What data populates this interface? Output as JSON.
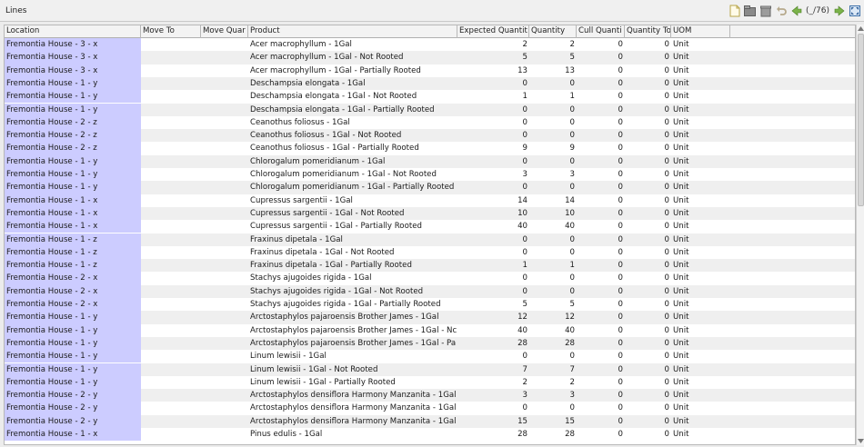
{
  "window": {
    "title": "Lines"
  },
  "toolbar": {
    "page_indicator": "(_/76)"
  },
  "columns": [
    "Location",
    "Move To",
    "Move Quar",
    "Product",
    "Expected Quantit",
    "Quantity",
    "Cull Quanti",
    "Quantity To",
    "UOM"
  ],
  "rows": [
    {
      "location": "Fremontia House - 3 - x",
      "move_to": "",
      "move_qty": "",
      "product": "Acer macrophyllum - 1Gal",
      "expected": "2",
      "quantity": "2",
      "cull": "0",
      "qty_to": "0",
      "uom": "Unit"
    },
    {
      "location": "Fremontia House - 3 - x",
      "move_to": "",
      "move_qty": "",
      "product": "Acer macrophyllum - 1Gal - Not Rooted",
      "expected": "5",
      "quantity": "5",
      "cull": "0",
      "qty_to": "0",
      "uom": "Unit"
    },
    {
      "location": "Fremontia House - 3 - x",
      "move_to": "",
      "move_qty": "",
      "product": "Acer macrophyllum - 1Gal - Partially Rooted",
      "expected": "13",
      "quantity": "13",
      "cull": "0",
      "qty_to": "0",
      "uom": "Unit"
    },
    {
      "location": "Fremontia House - 1 - y",
      "move_to": "",
      "move_qty": "",
      "product": "Deschampsia elongata - 1Gal",
      "expected": "0",
      "quantity": "0",
      "cull": "0",
      "qty_to": "0",
      "uom": "Unit"
    },
    {
      "location": "Fremontia House - 1 - y",
      "move_to": "",
      "move_qty": "",
      "product": "Deschampsia elongata - 1Gal - Not Rooted",
      "expected": "1",
      "quantity": "1",
      "cull": "0",
      "qty_to": "0",
      "uom": "Unit"
    },
    {
      "location": "Fremontia House - 1 - y",
      "move_to": "",
      "move_qty": "",
      "product": "Deschampsia elongata - 1Gal - Partially Rooted",
      "expected": "0",
      "quantity": "0",
      "cull": "0",
      "qty_to": "0",
      "uom": "Unit"
    },
    {
      "location": "Fremontia House - 2 - z",
      "move_to": "",
      "move_qty": "",
      "product": "Ceanothus foliosus - 1Gal",
      "expected": "0",
      "quantity": "0",
      "cull": "0",
      "qty_to": "0",
      "uom": "Unit"
    },
    {
      "location": "Fremontia House - 2 - z",
      "move_to": "",
      "move_qty": "",
      "product": "Ceanothus foliosus - 1Gal - Not Rooted",
      "expected": "0",
      "quantity": "0",
      "cull": "0",
      "qty_to": "0",
      "uom": "Unit"
    },
    {
      "location": "Fremontia House - 2 - z",
      "move_to": "",
      "move_qty": "",
      "product": "Ceanothus foliosus - 1Gal - Partially Rooted",
      "expected": "9",
      "quantity": "9",
      "cull": "0",
      "qty_to": "0",
      "uom": "Unit"
    },
    {
      "location": "Fremontia House - 1 - y",
      "move_to": "",
      "move_qty": "",
      "product": "Chlorogalum pomeridianum - 1Gal",
      "expected": "0",
      "quantity": "0",
      "cull": "0",
      "qty_to": "0",
      "uom": "Unit"
    },
    {
      "location": "Fremontia House - 1 - y",
      "move_to": "",
      "move_qty": "",
      "product": "Chlorogalum pomeridianum - 1Gal - Not Rooted",
      "expected": "3",
      "quantity": "3",
      "cull": "0",
      "qty_to": "0",
      "uom": "Unit"
    },
    {
      "location": "Fremontia House - 1 - y",
      "move_to": "",
      "move_qty": "",
      "product": "Chlorogalum pomeridianum - 1Gal - Partially Rooted",
      "expected": "0",
      "quantity": "0",
      "cull": "0",
      "qty_to": "0",
      "uom": "Unit"
    },
    {
      "location": "Fremontia House - 1 - x",
      "move_to": "",
      "move_qty": "",
      "product": "Cupressus sargentii - 1Gal",
      "expected": "14",
      "quantity": "14",
      "cull": "0",
      "qty_to": "0",
      "uom": "Unit"
    },
    {
      "location": "Fremontia House - 1 - x",
      "move_to": "",
      "move_qty": "",
      "product": "Cupressus sargentii - 1Gal - Not Rooted",
      "expected": "10",
      "quantity": "10",
      "cull": "0",
      "qty_to": "0",
      "uom": "Unit"
    },
    {
      "location": "Fremontia House - 1 - x",
      "move_to": "",
      "move_qty": "",
      "product": "Cupressus sargentii - 1Gal - Partially Rooted",
      "expected": "40",
      "quantity": "40",
      "cull": "0",
      "qty_to": "0",
      "uom": "Unit"
    },
    {
      "location": "Fremontia House - 1 - z",
      "move_to": "",
      "move_qty": "",
      "product": "Fraxinus dipetala - 1Gal",
      "expected": "0",
      "quantity": "0",
      "cull": "0",
      "qty_to": "0",
      "uom": "Unit"
    },
    {
      "location": "Fremontia House - 1 - z",
      "move_to": "",
      "move_qty": "",
      "product": "Fraxinus dipetala - 1Gal - Not Rooted",
      "expected": "0",
      "quantity": "0",
      "cull": "0",
      "qty_to": "0",
      "uom": "Unit"
    },
    {
      "location": "Fremontia House - 1 - z",
      "move_to": "",
      "move_qty": "",
      "product": "Fraxinus dipetala - 1Gal - Partially Rooted",
      "expected": "1",
      "quantity": "1",
      "cull": "0",
      "qty_to": "0",
      "uom": "Unit"
    },
    {
      "location": "Fremontia House - 2 - x",
      "move_to": "",
      "move_qty": "",
      "product": "Stachys ajugoides rigida - 1Gal",
      "expected": "0",
      "quantity": "0",
      "cull": "0",
      "qty_to": "0",
      "uom": "Unit"
    },
    {
      "location": "Fremontia House - 2 - x",
      "move_to": "",
      "move_qty": "",
      "product": "Stachys ajugoides rigida - 1Gal - Not Rooted",
      "expected": "0",
      "quantity": "0",
      "cull": "0",
      "qty_to": "0",
      "uom": "Unit"
    },
    {
      "location": "Fremontia House - 2 - x",
      "move_to": "",
      "move_qty": "",
      "product": "Stachys ajugoides rigida - 1Gal - Partially Rooted",
      "expected": "5",
      "quantity": "5",
      "cull": "0",
      "qty_to": "0",
      "uom": "Unit"
    },
    {
      "location": "Fremontia House - 1 - y",
      "move_to": "",
      "move_qty": "",
      "product": "Arctostaphylos pajaroensis Brother James - 1Gal",
      "expected": "12",
      "quantity": "12",
      "cull": "0",
      "qty_to": "0",
      "uom": "Unit"
    },
    {
      "location": "Fremontia House - 1 - y",
      "move_to": "",
      "move_qty": "",
      "product": "Arctostaphylos pajaroensis Brother James - 1Gal - Nc",
      "expected": "40",
      "quantity": "40",
      "cull": "0",
      "qty_to": "0",
      "uom": "Unit"
    },
    {
      "location": "Fremontia House - 1 - y",
      "move_to": "",
      "move_qty": "",
      "product": "Arctostaphylos pajaroensis Brother James - 1Gal - Pa",
      "expected": "28",
      "quantity": "28",
      "cull": "0",
      "qty_to": "0",
      "uom": "Unit"
    },
    {
      "location": "Fremontia House - 1 - y",
      "move_to": "",
      "move_qty": "",
      "product": "Linum lewisii - 1Gal",
      "expected": "0",
      "quantity": "0",
      "cull": "0",
      "qty_to": "0",
      "uom": "Unit"
    },
    {
      "location": "Fremontia House - 1 - y",
      "move_to": "",
      "move_qty": "",
      "product": "Linum lewisii - 1Gal - Not Rooted",
      "expected": "7",
      "quantity": "7",
      "cull": "0",
      "qty_to": "0",
      "uom": "Unit"
    },
    {
      "location": "Fremontia House - 1 - y",
      "move_to": "",
      "move_qty": "",
      "product": "Linum lewisii - 1Gal - Partially Rooted",
      "expected": "2",
      "quantity": "2",
      "cull": "0",
      "qty_to": "0",
      "uom": "Unit"
    },
    {
      "location": "Fremontia House - 2 - y",
      "move_to": "",
      "move_qty": "",
      "product": "Arctostaphylos densiflora Harmony  Manzanita - 1Gal",
      "expected": "3",
      "quantity": "3",
      "cull": "0",
      "qty_to": "0",
      "uom": "Unit"
    },
    {
      "location": "Fremontia House - 2 - y",
      "move_to": "",
      "move_qty": "",
      "product": "Arctostaphylos densiflora Harmony  Manzanita - 1Gal",
      "expected": "0",
      "quantity": "0",
      "cull": "0",
      "qty_to": "0",
      "uom": "Unit"
    },
    {
      "location": "Fremontia House - 2 - y",
      "move_to": "",
      "move_qty": "",
      "product": "Arctostaphylos densiflora Harmony  Manzanita - 1Gal",
      "expected": "15",
      "quantity": "15",
      "cull": "0",
      "qty_to": "0",
      "uom": "Unit"
    },
    {
      "location": "Fremontia House - 1 - x",
      "move_to": "",
      "move_qty": "",
      "product": "Pinus edulis - 1Gal",
      "expected": "28",
      "quantity": "28",
      "cull": "0",
      "qty_to": "0",
      "uom": "Unit"
    }
  ],
  "colors": {
    "location_column": "#ccccff",
    "row_alt": "#efefef"
  }
}
